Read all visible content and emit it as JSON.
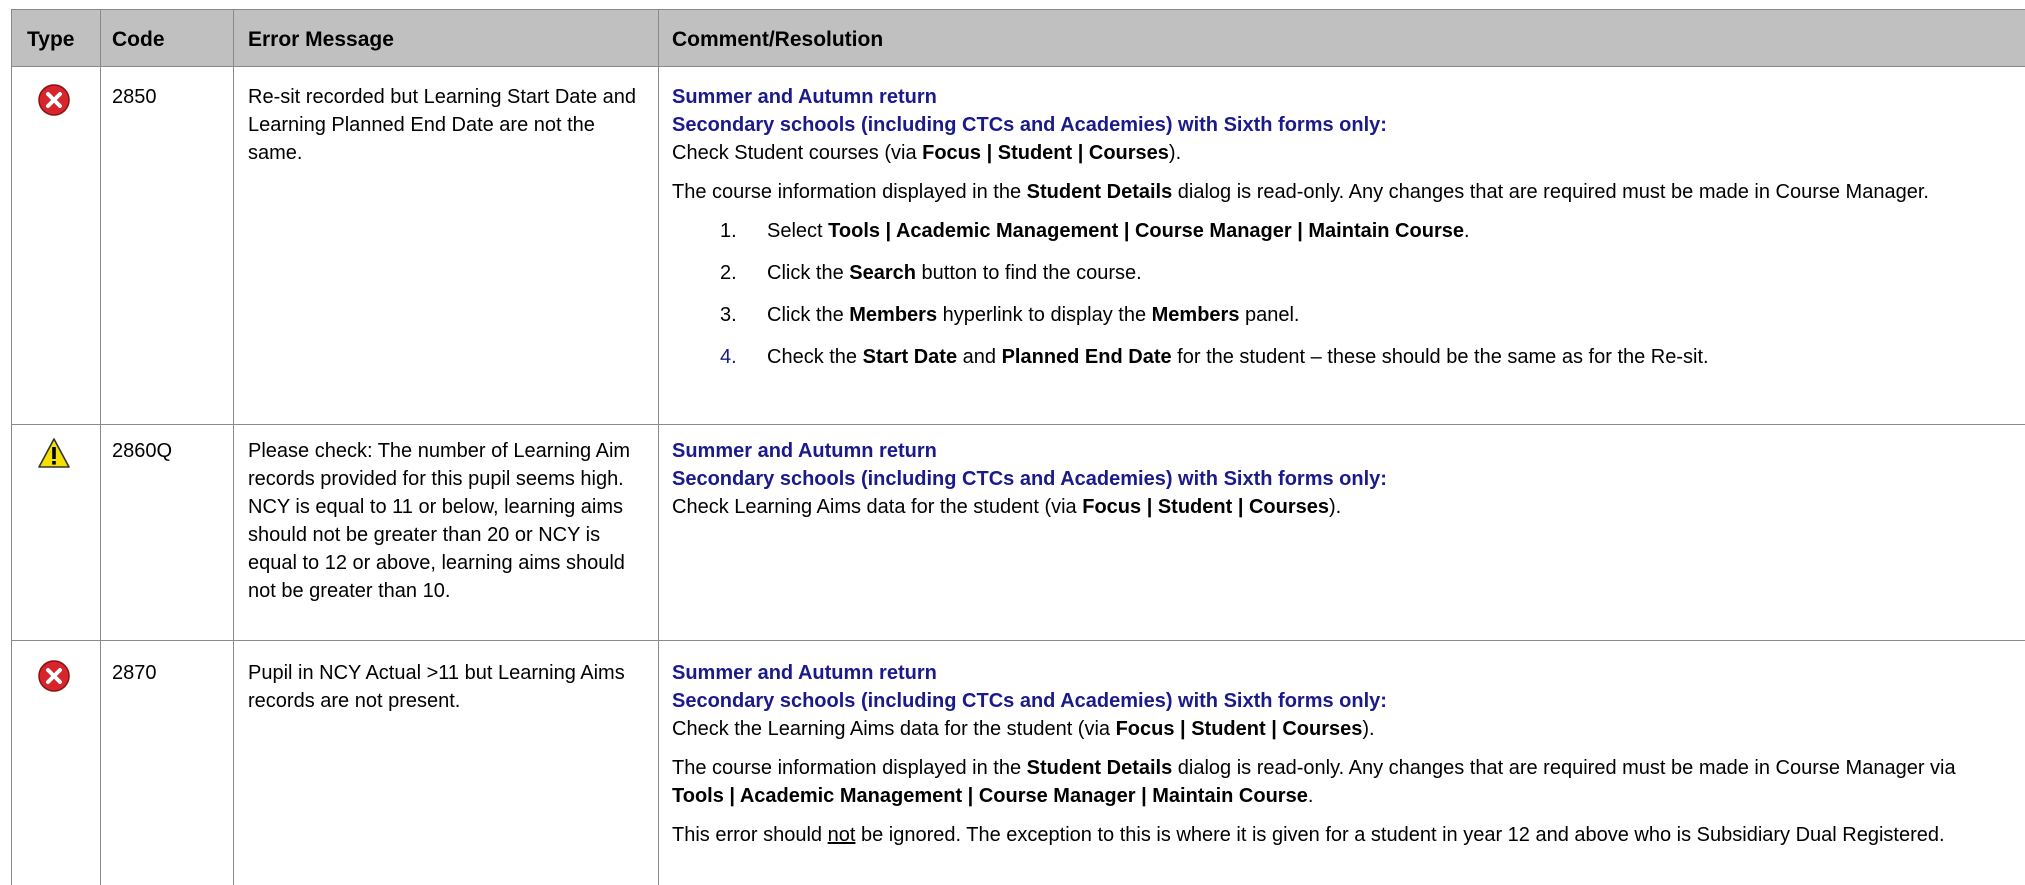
{
  "header": {
    "type": "Type",
    "code": "Code",
    "error_message": "Error Message",
    "comment": "Comment/Resolution"
  },
  "rows": [
    {
      "icon": "error-icon",
      "code": "2850",
      "message": "Re-sit recorded but Learning Start Date and Learning Planned End Date are not the same.",
      "return_heading": "Summer and Autumn return",
      "schools_heading": "Secondary schools (including CTCs and Academies) with Sixth forms only:",
      "check_pre": "Check Student courses (via ",
      "check_bold": "Focus | Student | Courses",
      "check_post": ").",
      "info_pre": "The course information displayed in the ",
      "info_bold": "Student Details",
      "info_post": " dialog is read-only. Any changes that are required must be made in Course Manager.",
      "steps": [
        {
          "num": "1.",
          "pre": "Select ",
          "b1": "Tools | Academic Management | Course Manager | Maintain Course",
          "mid": ".",
          "b2": "",
          "post": ""
        },
        {
          "num": "2.",
          "pre": "Click the ",
          "b1": "Search",
          "mid": " button to find the course.",
          "b2": "",
          "post": ""
        },
        {
          "num": "3.",
          "pre": "Click the ",
          "b1": "Members",
          "mid": " hyperlink to display the ",
          "b2": "Members",
          "post": " panel."
        },
        {
          "num": "4.",
          "pre": "Check the ",
          "b1": "Start Date",
          "mid": " and ",
          "b2": "Planned End Date",
          "post": " for the student – these should be the same as for the Re-sit."
        }
      ]
    },
    {
      "icon": "warning-icon",
      "code": "2860Q",
      "message": "Please check: The number of Learning Aim records provided for this pupil seems high. NCY is equal to 11 or below, learning aims should not be greater than 20 or NCY is equal to 12 or above, learning aims should not be greater than 10.",
      "return_heading": "Summer and Autumn return",
      "schools_heading": "Secondary schools (including CTCs and Academies) with Sixth forms only:",
      "check_pre": "Check Learning Aims data for the student (via ",
      "check_bold": "Focus | Student | Courses",
      "check_post": ")."
    },
    {
      "icon": "error-icon",
      "code": "2870",
      "message": "Pupil in NCY Actual >11 but Learning Aims records are not present.",
      "return_heading": "Summer and Autumn return",
      "schools_heading": "Secondary schools (including CTCs and Academies) with Sixth forms only:",
      "check_pre": "Check the Learning Aims data for the student (via ",
      "check_bold": "Focus | Student | Courses",
      "check_post": ").",
      "info_pre": "The course information displayed in the ",
      "info_bold": "Student Details",
      "info_mid": " dialog is read-only. Any changes that are required must be made in Course Manager via ",
      "info_bold2": "Tools | Academic Management | Course Manager | Maintain Course",
      "info_post": ".",
      "note_pre": "This error should ",
      "note_u": "not",
      "note_post": " be ignored. The exception to this is where it is given for a student in year 12 and above who is Subsidiary Dual Registered."
    }
  ],
  "colors": {
    "header_bg": "#c0c0c0",
    "heading_blue": "#1a1a8c",
    "grid": "#8a8a8a",
    "error_red": "#d7262b",
    "warning_yellow": "#f5e000"
  }
}
